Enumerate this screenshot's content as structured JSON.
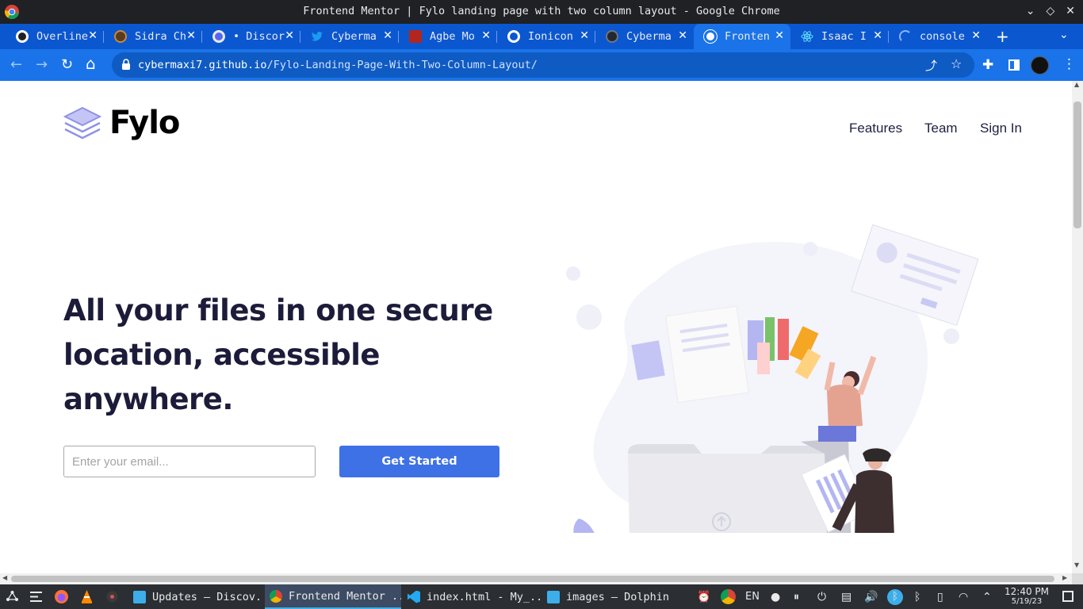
{
  "window": {
    "title": "Frontend Mentor | Fylo landing page with two column layout - Google Chrome"
  },
  "tabs": [
    {
      "label": "Overline",
      "fav_color": "#ffffff",
      "active": false
    },
    {
      "label": "Sidra Ch",
      "fav_color": "#c48b3c",
      "active": false
    },
    {
      "label": "• Discor",
      "fav_color": "#5865f2",
      "active": false
    },
    {
      "label": "Cyberma",
      "fav_color": "#1d9bf0",
      "active": false
    },
    {
      "label": "Agbe Mo",
      "fav_color": "#b3261e",
      "active": false
    },
    {
      "label": "Ionicon",
      "fav_color": "#ffffff",
      "active": false
    },
    {
      "label": "Cyberma",
      "fav_color": "#24292f",
      "active": false
    },
    {
      "label": "Fronten",
      "fav_color": "#ffffff",
      "active": true
    },
    {
      "label": "Isaac I",
      "fav_color": "#61dafb",
      "active": false
    },
    {
      "label": "console",
      "fav_color": "#8ab4f8",
      "active": false
    }
  ],
  "toolbar": {
    "back": "←",
    "forward": "→",
    "reload": "↻",
    "home": "⌂",
    "url_host": "cybermaxi7.github.io",
    "url_path": "/Fylo-Landing-Page-With-Two-Column-Layout/",
    "share": "⤴",
    "star": "☆",
    "extensions": "✚",
    "menu": "⋮",
    "new_tab": "+",
    "tab_search": "⌄",
    "tab_close": "✕",
    "window_buttons": [
      "⌄",
      "◇",
      "✕"
    ]
  },
  "page": {
    "logo_text": "Fylo",
    "nav": [
      "Features",
      "Team",
      "Sign In"
    ],
    "headline": "All your files in one secure location, accessible anywhere.",
    "email_placeholder": "Enter your email...",
    "cta_label": "Get Started"
  },
  "taskbar": {
    "items": [
      {
        "label": "Updates — Discov...",
        "active": false,
        "color": "#3daee9"
      },
      {
        "label": "Frontend Mentor ...",
        "active": true,
        "color": "#4285f4"
      },
      {
        "label": "index.html - My_...",
        "active": false,
        "color": "#23a9f2"
      },
      {
        "label": "images — Dolphin",
        "active": false,
        "color": "#3daee9"
      }
    ],
    "lang": "EN",
    "time": "12:40 PM",
    "date": "5/19/23"
  },
  "colors": {
    "tab_strip": "#0b57d0",
    "toolbar": "#1a73e8",
    "cta": "#3e71e6",
    "headline": "#1c1c3a",
    "taskbar": "#2b2e33"
  }
}
